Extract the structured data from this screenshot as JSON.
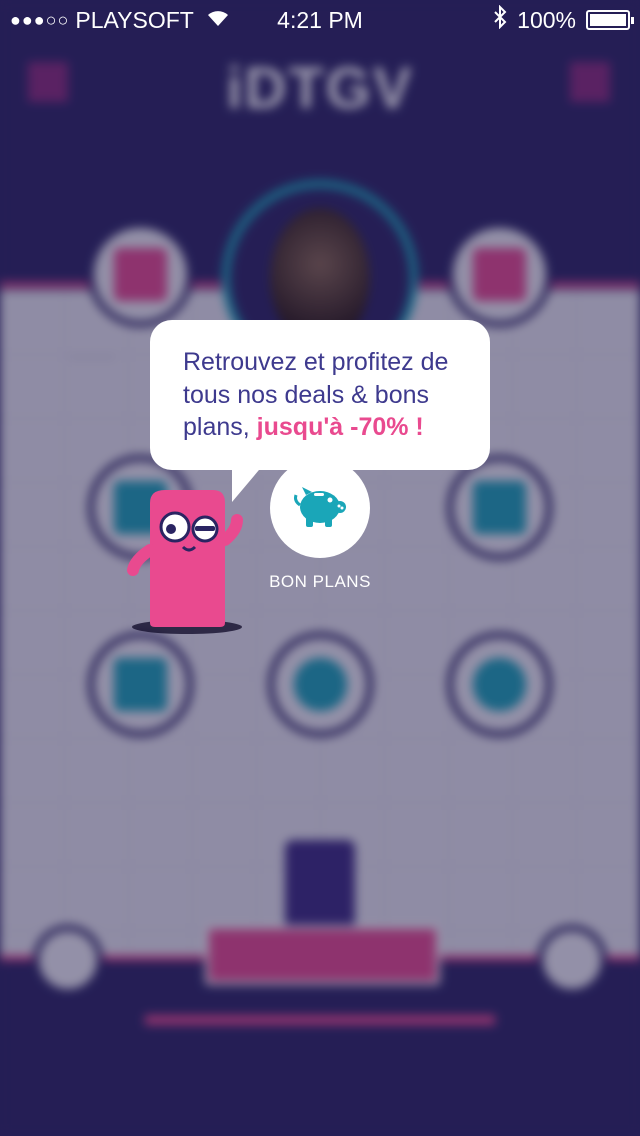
{
  "status_bar": {
    "signal_dots": "●●●○○",
    "carrier": "PLAYSOFT",
    "time": "4:21 PM",
    "battery": "100%",
    "battery_level": 1.0,
    "icons": [
      "wifi-icon",
      "bluetooth-icon",
      "battery-icon"
    ]
  },
  "app": {
    "logo": "iDTGV"
  },
  "tooltip": {
    "text": "Retrouvez et profitez de tous nos deals & bons plans, ",
    "highlight": "jusqu'à -70% !"
  },
  "feature": {
    "label": "BON PLANS",
    "icon": "piggy-bank-icon"
  },
  "colors": {
    "navy": "#2a2462",
    "pink": "#e94a8f",
    "teal": "#1aa6b8",
    "bubble_text": "#3e3a8e"
  }
}
